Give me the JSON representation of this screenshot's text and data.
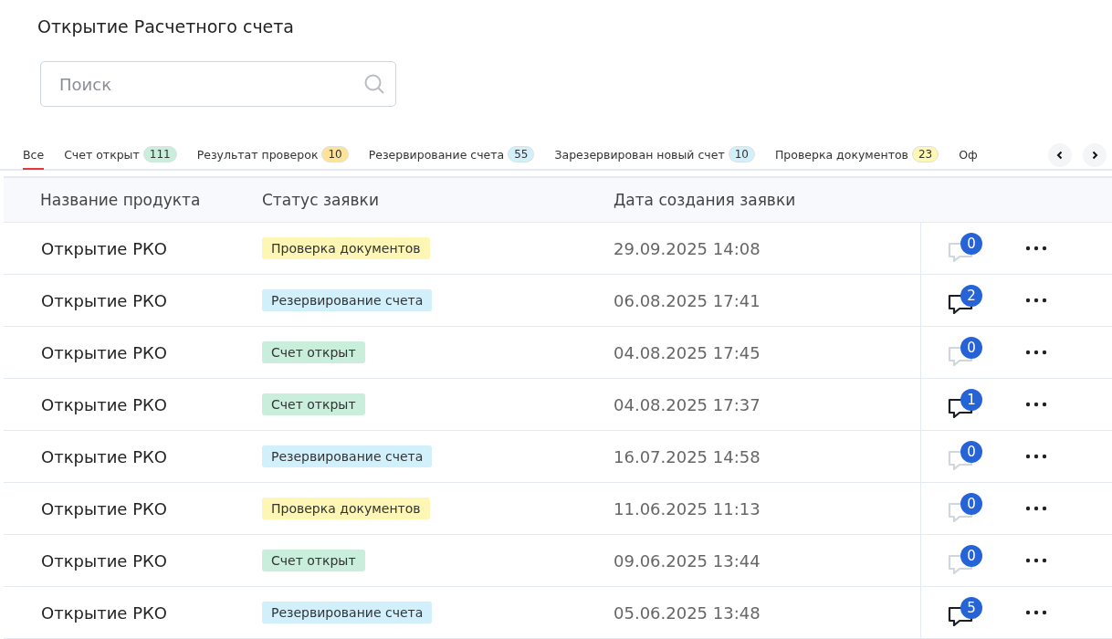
{
  "title": "Открытие Расчетного счета",
  "search": {
    "placeholder": "Поиск"
  },
  "tabs": [
    {
      "label": "Все",
      "selected": true
    },
    {
      "label": "Счет открыт",
      "count": "111",
      "color": "#c9eedb",
      "selected": false
    },
    {
      "label": "Результат проверок",
      "count": "10",
      "color": "#fde39a",
      "selected": false
    },
    {
      "label": "Резервирование счета",
      "count": "55",
      "color": "#d2f0fb",
      "selected": false
    },
    {
      "label": "Зарезервирован новый счет",
      "count": "10",
      "color": "#d2f0fb",
      "selected": false
    },
    {
      "label": "Проверка документов",
      "count": "23",
      "color": "#fdf6b5",
      "selected": false
    },
    {
      "label": "Оф",
      "selected": false
    }
  ],
  "table": {
    "columns": [
      "Название продукта",
      "Статус заявки",
      "Дата создания заявки"
    ],
    "rows": [
      {
        "product": "Открытие РКО",
        "status": "Проверка документов",
        "color": "#fdf6b5",
        "date": "29.09.2025 14:08",
        "comments": "0",
        "active": false
      },
      {
        "product": "Открытие РКО",
        "status": "Резервирование счета",
        "color": "#d2f0fb",
        "date": "06.08.2025 17:41",
        "comments": "2",
        "active": true
      },
      {
        "product": "Открытие РКО",
        "status": "Счет открыт",
        "color": "#c9eedb",
        "date": "04.08.2025 17:45",
        "comments": "0",
        "active": false
      },
      {
        "product": "Открытие РКО",
        "status": "Счет открыт",
        "color": "#c9eedb",
        "date": "04.08.2025 17:37",
        "comments": "1",
        "active": true
      },
      {
        "product": "Открытие РКО",
        "status": "Резервирование счета",
        "color": "#d2f0fb",
        "date": "16.07.2025 14:58",
        "comments": "0",
        "active": false
      },
      {
        "product": "Открытие РКО",
        "status": "Проверка документов",
        "color": "#fdf6b5",
        "date": "11.06.2025 11:13",
        "comments": "0",
        "active": false
      },
      {
        "product": "Открытие РКО",
        "status": "Счет открыт",
        "color": "#c9eedb",
        "date": "09.06.2025 13:44",
        "comments": "0",
        "active": false
      },
      {
        "product": "Открытие РКО",
        "status": "Резервирование счета",
        "color": "#d2f0fb",
        "date": "05.06.2025 13:48",
        "comments": "5",
        "active": true
      }
    ]
  }
}
